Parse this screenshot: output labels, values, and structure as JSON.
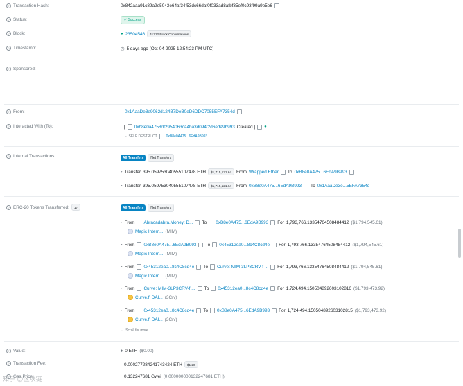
{
  "tx": {
    "hash_label": "Transaction Hash:",
    "hash": "0x842aaa91c89a9e5043e64af34f53dc66daf0f033ad8afbf35ef0c93f99a9e5e6",
    "status_label": "Status:",
    "status": "Success",
    "block_label": "Block:",
    "block": "23504546",
    "confirmations": "41712 Block Confirmations",
    "timestamp_label": "Timestamp:",
    "timestamp": "5 days ago (Oct-04-2025 12:54:23 PM UTC)",
    "sponsored_label": "Sponsored:",
    "from_label": "From:",
    "from": "0x1AaaDe3e9062d124B7DeB0eD6DDC7055EFA7354d",
    "interacted_label": "Interacted With (To):",
    "interacted_bracket_open": "[",
    "interacted_address": "0xb8e0a4758df2954063ca4ba3d094f2d6eda9b993",
    "interacted_status": "Created ]",
    "self_destruct_label": "SELF DESTRUCT",
    "self_destruct_address": "0xB8e0A475...6EdA9B993"
  },
  "internal": {
    "label": "Internal Transactions:",
    "tab_all": "All Transfers",
    "tab_net": "Net Transfers",
    "rows": [
      {
        "prefix": "Transfer",
        "amount": "395.059753040555107478 ETH",
        "usd": "$1,715,121.64",
        "from_word": "From",
        "from": "Wrapped Ether",
        "to_word": "To",
        "to": "0xB8e0A475...6EdA9B993"
      },
      {
        "prefix": "Transfer",
        "amount": "395.059753040555107478 ETH",
        "usd": "$1,715,121.64",
        "from_word": "From",
        "from": "0xB8e0A475...6EdA9B993",
        "to_word": "To",
        "to": "0x1AaaDe3e...5EFA7354d"
      }
    ]
  },
  "erc20": {
    "label": "ERC-20 Tokens Transferred:",
    "count": "17",
    "tab_all": "All Transfers",
    "tab_net": "Net Transfers",
    "rows": [
      {
        "from_word": "From",
        "from": "Abracadabra.Money: D...",
        "to_word": "To",
        "to": "0xB8e0A475...6EdA9B993",
        "for_word": "For",
        "amount": "1,793,766.13354764508484412",
        "usd": "($1,794,545.61)",
        "token": "Magic Intern...",
        "symbol": "(MIM)"
      },
      {
        "from_word": "From",
        "from": "0xB8e0A475...6EdA9B993",
        "to_word": "To",
        "to": "0x45312ea0...8c4C8cd4e",
        "for_word": "For",
        "amount": "1,793,766.13354764508484412",
        "usd": "($1,794,545.61)",
        "token": "Magic Intern...",
        "symbol": "(MIM)"
      },
      {
        "from_word": "From",
        "from": "0x45312ea0...8c4C8cd4e",
        "to_word": "To",
        "to": "Curve: MIM-3LP3CRV-f ...",
        "for_word": "For",
        "amount": "1,793,766.13354764508484412",
        "usd": "($1,794,545.61)",
        "token": "Magic Intern...",
        "symbol": "(MIM)"
      },
      {
        "from_word": "From",
        "from": "Curve: MIM-3LP3CRV-f ...",
        "to_word": "To",
        "to": "0x45312ea0...8c4C8cd4e",
        "for_word": "For",
        "amount": "1,724,494.150504892603102816",
        "usd": "($1,793,473.92)",
        "token": "Curve.fi DAI...",
        "symbol": "(3Crv)"
      },
      {
        "from_word": "From",
        "from": "0x45312ea0...8c4C8cd4e",
        "to_word": "To",
        "to": "0xB8e0A475...6EdA9B993",
        "for_word": "For",
        "amount": "1,724,494.150504892603102815",
        "usd": "($1,793,473.92)",
        "token": "Curve.fi DAI...",
        "symbol": "(3Crv)"
      }
    ],
    "scroll_more": "Scroll for more"
  },
  "value": {
    "label": "Value:",
    "amount": "0 ETH",
    "usd": "($0.00)"
  },
  "fee": {
    "label": "Transaction Fee:",
    "amount": "0.000277284241743424 ETH",
    "usd": "$1.20"
  },
  "gas": {
    "label": "Gas Price:",
    "amount": "0.132247681 Gwei",
    "detail": "(0.000000000132247681 ETH)"
  },
  "watermark": "知乎 @区块链"
}
